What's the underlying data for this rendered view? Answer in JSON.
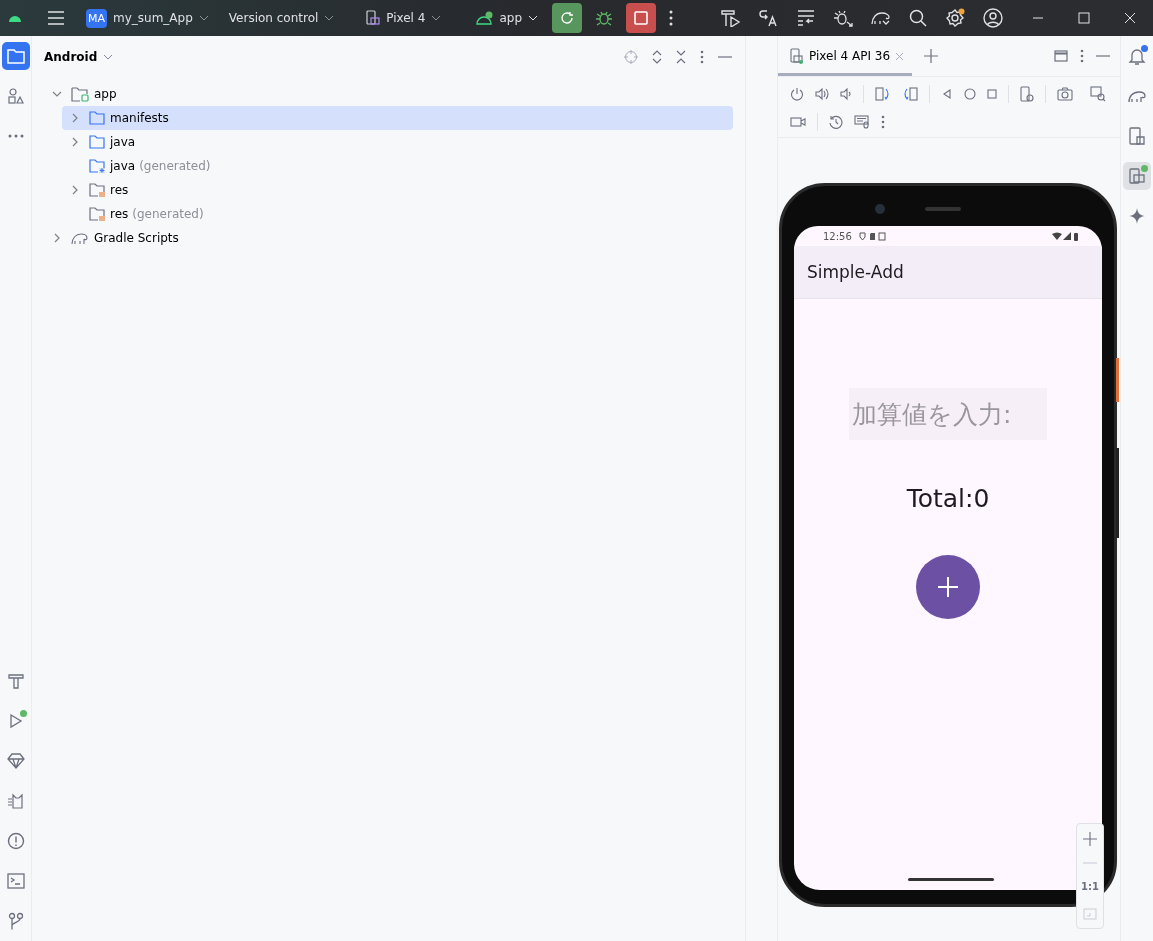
{
  "title_bar": {
    "project_badge": "MA",
    "project": "my_sum_App",
    "vcs": "Version control",
    "device": "Pixel 4",
    "run_config": "app",
    "run_config_dot": true,
    "settings_dot": true
  },
  "left_stripe": {
    "top": [
      {
        "kind": "project",
        "selected": true
      },
      {
        "kind": "structure",
        "selected": false
      },
      {
        "kind": "more",
        "selected": false
      }
    ],
    "bottom": [
      {
        "kind": "build",
        "dot": false
      },
      {
        "kind": "run",
        "dot": true
      },
      {
        "kind": "gem",
        "dot": false
      },
      {
        "kind": "logcat",
        "dot": false
      },
      {
        "kind": "problems",
        "dot": false
      },
      {
        "kind": "terminal",
        "dot": false
      },
      {
        "kind": "git",
        "dot": false
      }
    ]
  },
  "project_panel": {
    "title": "Android",
    "tree": [
      {
        "label": "app",
        "kind": "module",
        "expandable": true,
        "expanded": true,
        "selected": false,
        "children": [
          {
            "label": "manifests",
            "kind": "folder",
            "expandable": true,
            "expanded": false,
            "selected": true
          },
          {
            "label": "java",
            "kind": "folder",
            "expandable": true,
            "expanded": false,
            "selected": false
          },
          {
            "label": "java",
            "suffix": "(generated)",
            "kind": "generated",
            "expandable": false,
            "expanded": false,
            "selected": false
          },
          {
            "label": "res",
            "kind": "resources",
            "expandable": true,
            "expanded": false,
            "selected": false
          },
          {
            "label": "res",
            "suffix": "(generated)",
            "kind": "resources",
            "expandable": false,
            "expanded": false,
            "selected": false
          }
        ]
      },
      {
        "label": "Gradle Scripts",
        "kind": "gradle",
        "expandable": true,
        "expanded": false,
        "selected": false
      }
    ]
  },
  "emulator": {
    "tab": "Pixel 4 API 36",
    "status_time": "12:56",
    "app_title": "Simple-Add",
    "input_placeholder": "加算値を入力:",
    "total": "Total:0",
    "zoom_actual": "1:1"
  },
  "right_stripe": [
    {
      "kind": "notifications",
      "selected": false,
      "dot": true
    },
    {
      "kind": "gradle",
      "selected": false,
      "dot": false
    },
    {
      "kind": "device_manager",
      "selected": false,
      "dot": false
    },
    {
      "kind": "running_devices",
      "selected": true,
      "dot": true
    },
    {
      "kind": "gemini",
      "selected": false,
      "dot": false
    }
  ]
}
